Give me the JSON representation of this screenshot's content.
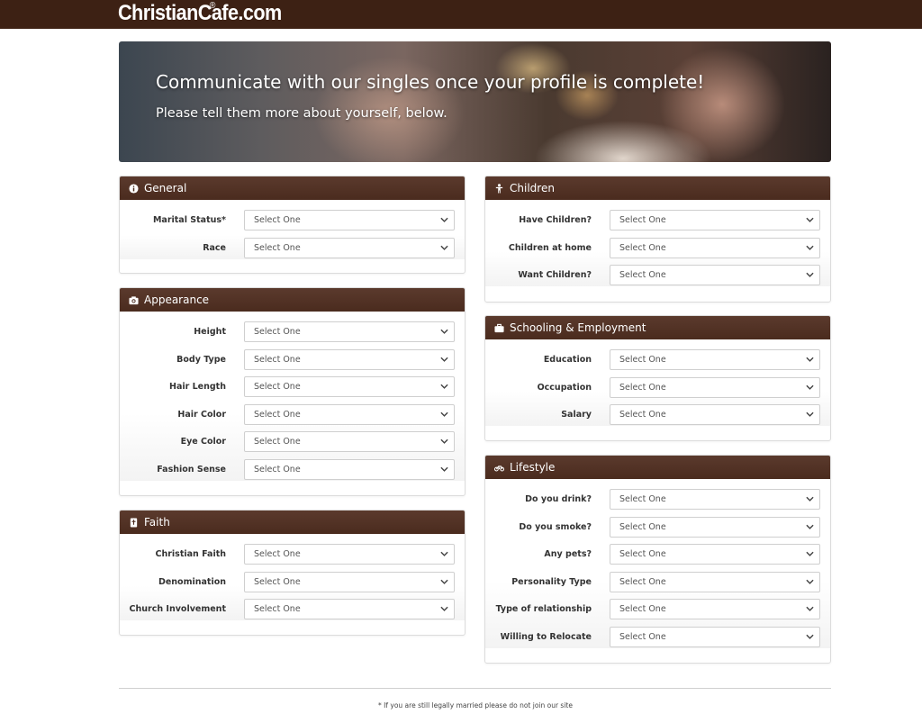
{
  "brand": {
    "logo_text": "ChristianCafe.com",
    "reg_mark": "®",
    "bar_color": "#3d2114",
    "panel_header_color": "#553426"
  },
  "hero": {
    "title": "Communicate with our singles once your profile is complete!",
    "subtitle": "Please tell them more about yourself, below."
  },
  "placeholder": "Select One",
  "panels": {
    "general": {
      "title": "General",
      "icon": "info-icon",
      "fields": [
        {
          "label": "Marital Status*",
          "value": "Select One"
        },
        {
          "label": "Race",
          "value": "Select One"
        }
      ]
    },
    "appearance": {
      "title": "Appearance",
      "icon": "camera-icon",
      "fields": [
        {
          "label": "Height",
          "value": "Select One"
        },
        {
          "label": "Body Type",
          "value": "Select One"
        },
        {
          "label": "Hair Length",
          "value": "Select One"
        },
        {
          "label": "Hair Color",
          "value": "Select One"
        },
        {
          "label": "Eye Color",
          "value": "Select One"
        },
        {
          "label": "Fashion Sense",
          "value": "Select One"
        }
      ]
    },
    "faith": {
      "title": "Faith",
      "icon": "bible-icon",
      "fields": [
        {
          "label": "Christian Faith",
          "value": "Select One"
        },
        {
          "label": "Denomination",
          "value": "Select One"
        },
        {
          "label": "Church Involvement",
          "value": "Select One"
        }
      ]
    },
    "children": {
      "title": "Children",
      "icon": "child-icon",
      "fields": [
        {
          "label": "Have Children?",
          "value": "Select One"
        },
        {
          "label": "Children at home",
          "value": "Select One"
        },
        {
          "label": "Want Children?",
          "value": "Select One"
        }
      ]
    },
    "schooling": {
      "title": "Schooling & Employment",
      "icon": "briefcase-icon",
      "fields": [
        {
          "label": "Education",
          "value": "Select One"
        },
        {
          "label": "Occupation",
          "value": "Select One"
        },
        {
          "label": "Salary",
          "value": "Select One"
        }
      ]
    },
    "lifestyle": {
      "title": "Lifestyle",
      "icon": "bicycle-icon",
      "fields": [
        {
          "label": "Do you drink?",
          "value": "Select One"
        },
        {
          "label": "Do you smoke?",
          "value": "Select One"
        },
        {
          "label": "Any pets?",
          "value": "Select One"
        },
        {
          "label": "Personality Type",
          "value": "Select One"
        },
        {
          "label": "Type of relationship",
          "value": "Select One"
        },
        {
          "label": "Willing to Relocate",
          "value": "Select One"
        }
      ]
    }
  },
  "footnote": "* If you are still legally married please do not join our site"
}
